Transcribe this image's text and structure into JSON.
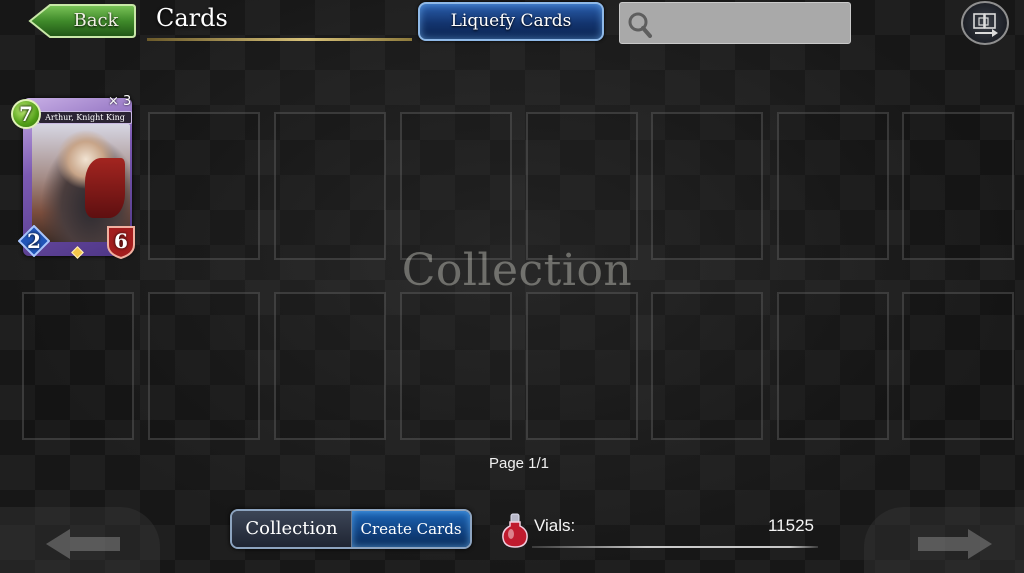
{
  "header": {
    "back_label": "Back",
    "title": "Cards",
    "liquefy_label": "Liquefy Cards",
    "search": {
      "placeholder": "",
      "value": ""
    },
    "filter_icon": "card-filter-icon"
  },
  "grid": {
    "watermark": "Collection",
    "cards": [
      {
        "name": "Arthur, Knight King",
        "cost": "7",
        "attack": "2",
        "defense": "6",
        "count": "× 3"
      }
    ],
    "empty_slots": 15
  },
  "pagination": {
    "page_label": "Page 1/1"
  },
  "footer": {
    "tabs": [
      {
        "label": "Collection",
        "active": false
      },
      {
        "label": "Create Cards",
        "active": true
      }
    ],
    "vials_label": "Vials:",
    "vials_value": "11525"
  },
  "colors": {
    "accent_blue": "#1c66b8",
    "back_green": "#3f8a2a",
    "cost_green": "#52a017",
    "attack_blue": "#2155b8",
    "defense_red": "#a31d1d"
  }
}
